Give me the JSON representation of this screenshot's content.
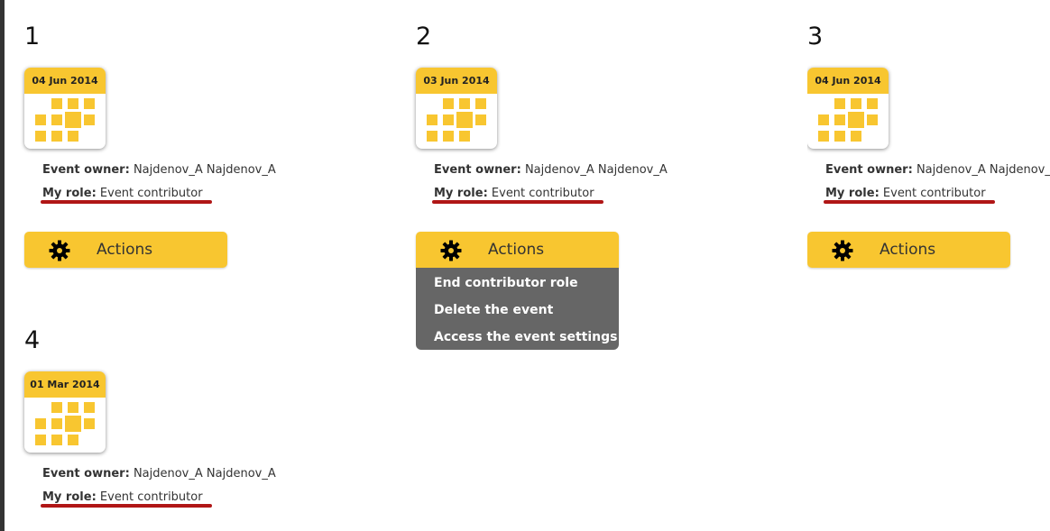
{
  "owner_label": "Event owner",
  "role_label": "My role",
  "events": [
    {
      "number": "1",
      "date": "04 Jun 2014",
      "owner": "Najdenov_A Najdenov_A",
      "role": "Event contributor",
      "actions_label": "Actions"
    },
    {
      "number": "2",
      "date": "03 Jun 2014",
      "owner": "Najdenov_A Najdenov_A",
      "role": "Event contributor",
      "actions_label": "Actions"
    },
    {
      "number": "3",
      "date": "04 Jun 2014",
      "owner": "Najdenov_A Najdenov_A",
      "role": "Event contributor",
      "actions_label": "Actions"
    },
    {
      "number": "4",
      "date": "01 Mar 2014",
      "owner": "Najdenov_A Najdenov_A",
      "role": "Event contributor"
    }
  ],
  "actions_menu": {
    "items": [
      "End contributor role",
      "Delete the event",
      "Access the event settings"
    ]
  },
  "colors": {
    "accent": "#f8c630",
    "menu_bg": "#666666",
    "underline": "#b01616"
  },
  "icons": {
    "actions": "gear-icon",
    "calendar": "calendar-icon"
  }
}
